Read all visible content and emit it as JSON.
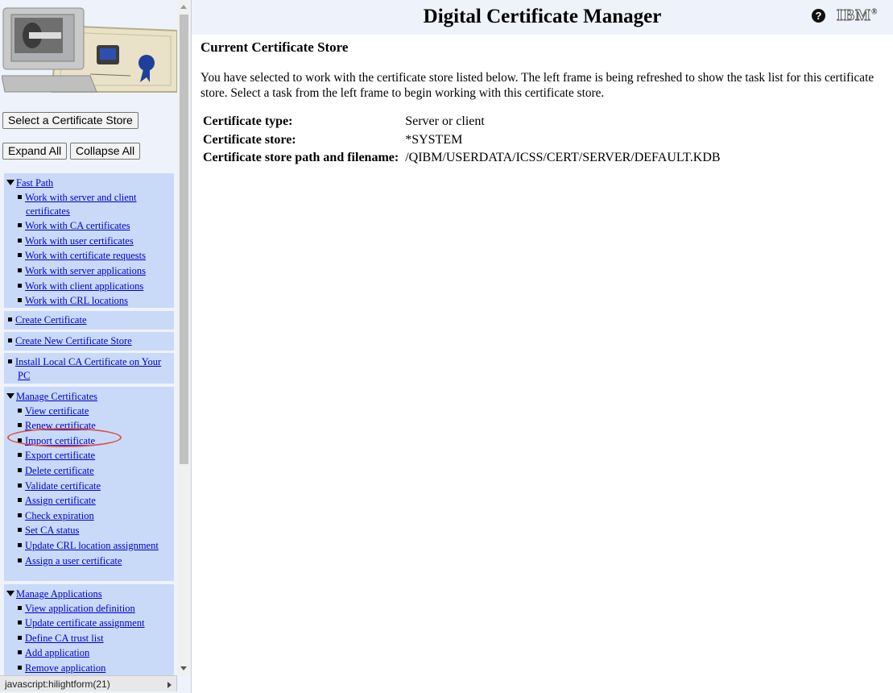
{
  "left_frame": {
    "select_store_button": "Select a Certificate Store",
    "expand_all_button": "Expand All",
    "collapse_all_button": "Collapse All",
    "nav": {
      "fast_path": {
        "label": "Fast Path",
        "items": [
          "Work with server and client certificates",
          "Work with CA certificates",
          "Work with user certificates",
          "Work with certificate requests",
          "Work with server applications",
          "Work with client applications",
          "Work with CRL locations"
        ]
      },
      "create_certificate": "Create Certificate",
      "create_new_store": "Create New Certificate Store",
      "install_local_ca": "Install Local CA Certificate on Your PC",
      "manage_certificates": {
        "label": "Manage Certificates",
        "items": [
          "View certificate",
          "Renew certificate",
          "Import certificate",
          "Export certificate",
          "Delete certificate",
          "Validate certificate",
          "Assign certificate",
          "Check expiration",
          "Set CA status",
          "Update CRL location assignment",
          "Assign a user certificate"
        ],
        "highlighted_item": "Import certificate"
      },
      "manage_applications": {
        "label": "Manage Applications",
        "items": [
          "View application definition",
          "Update certificate assignment",
          "Define CA trust list",
          "Add application",
          "Remove application"
        ]
      }
    },
    "status_bar_text": "javascript:hilightform(21)",
    "highlight_color": "#d9534f"
  },
  "right_frame": {
    "title": "Digital Certificate Manager",
    "help_icon": "help-icon",
    "logo_text": "IBM",
    "section_heading": "Current Certificate Store",
    "info_text": "You have selected to work with the certificate store listed below. The left frame is being refreshed to show the task list for this certificate store. Select a task from the left frame to begin working with this certificate store.",
    "details": [
      {
        "label": "Certificate type:",
        "value": "Server or client"
      },
      {
        "label": "Certificate store:",
        "value": "*SYSTEM"
      },
      {
        "label": "Certificate store path and filename:",
        "value": "/QIBM/USERDATA/ICSS/CERT/SERVER/DEFAULT.KDB"
      }
    ]
  },
  "colors": {
    "nav_box_bg": "#c8daf8",
    "link_color": "#0000cc",
    "banner_bg": "#eef2fa"
  }
}
